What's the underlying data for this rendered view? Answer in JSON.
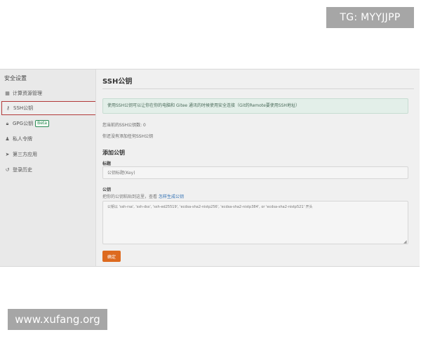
{
  "watermarks": {
    "top": "TG: MYYJJPP",
    "bottom": "www.xufang.org"
  },
  "sidebar": {
    "title": "安全设置",
    "items": [
      {
        "label": "计算资源管理",
        "icon": "grid-icon"
      },
      {
        "label": "SSH公钥",
        "icon": "key-icon",
        "active": true
      },
      {
        "label": "GPG公钥",
        "icon": "lock-icon",
        "badge": "Beta"
      },
      {
        "label": "私人令牌",
        "icon": "user-icon"
      },
      {
        "label": "第三方应用",
        "icon": "send-icon"
      },
      {
        "label": "登录历史",
        "icon": "history-icon"
      }
    ]
  },
  "main": {
    "title": "SSH公钥",
    "info": "使用SSH公钥可以让你在你的电脑和 Gitee 通讯的时候使用安全连接（Git的Remote要使用SSH地址）",
    "count_text": "您当前的SSH公钥数: 0",
    "empty_text": "你还没有添加任何SSH公钥",
    "add_title": "添加公钥",
    "label_title": "标题",
    "title_placeholder": "公钥标题(Key)",
    "label_key": "公钥",
    "key_hint": "把你的公钥粘贴到这里，查看",
    "key_hint_link": "怎样生成公钥",
    "key_placeholder": "公钥以 'ssh-rsa', 'ssh-dss', 'ssh-ed25519', 'ecdsa-sha2-nistp256', 'ecdsa-sha2-nistp384', or 'ecdsa-sha2-nistp521' 开头",
    "confirm_label": "确定"
  },
  "colors": {
    "active_border": "#b23a3a",
    "confirm_button": "#dd6a1f",
    "info_bg": "#e3efe9",
    "link": "#2f6fb3"
  }
}
